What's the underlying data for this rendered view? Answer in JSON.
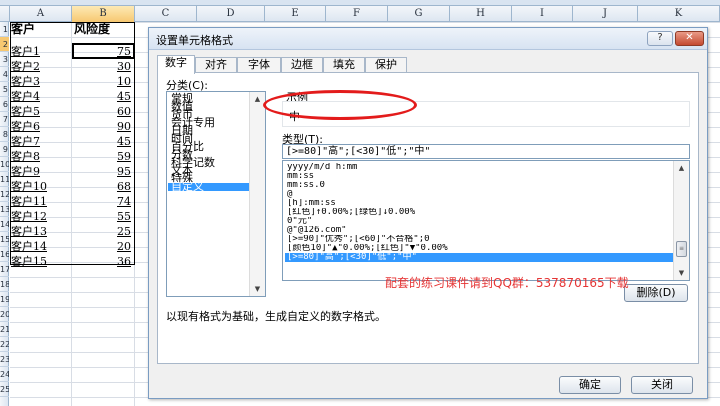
{
  "formula_bar": {
    "cell_ref": "B2",
    "fx_text": "75"
  },
  "columns": [
    "A",
    "B",
    "C",
    "D",
    "E",
    "F",
    "G",
    "H",
    "I",
    "J",
    "K"
  ],
  "rows": [
    "1",
    "2",
    "3",
    "4",
    "5",
    "6",
    "7",
    "8",
    "9",
    "10",
    "11",
    "12",
    "13",
    "14",
    "15",
    "16",
    "17",
    "18",
    "19",
    "20",
    "21",
    "22",
    "23",
    "24",
    "25"
  ],
  "sheet": {
    "header": {
      "a": "客户",
      "b": "风险度"
    },
    "data": [
      {
        "a": "客户1",
        "b": "75"
      },
      {
        "a": "客户2",
        "b": "30"
      },
      {
        "a": "客户3",
        "b": "10"
      },
      {
        "a": "客户4",
        "b": "45"
      },
      {
        "a": "客户5",
        "b": "60"
      },
      {
        "a": "客户6",
        "b": "90"
      },
      {
        "a": "客户7",
        "b": "45"
      },
      {
        "a": "客户8",
        "b": "59"
      },
      {
        "a": "客户9",
        "b": "95"
      },
      {
        "a": "客户10",
        "b": "68"
      },
      {
        "a": "客户11",
        "b": "74"
      },
      {
        "a": "客户12",
        "b": "55"
      },
      {
        "a": "客户13",
        "b": "25"
      },
      {
        "a": "客户14",
        "b": "20"
      },
      {
        "a": "客户15",
        "b": "36"
      }
    ]
  },
  "dialog": {
    "title": "设置单元格格式",
    "help_label": "?",
    "close_label": "✕",
    "tabs": [
      "数字",
      "对齐",
      "字体",
      "边框",
      "填充",
      "保护"
    ],
    "category_label": "分类(C):",
    "categories": [
      "常规",
      "数值",
      "货币",
      "会计专用",
      "日期",
      "时间",
      "百分比",
      "分数",
      "科学记数",
      "文本",
      "特殊",
      "自定义"
    ],
    "sample_label": "示例",
    "sample_value": "中",
    "type_label": "类型(T):",
    "type_value": "[>=80]\"高\";[<30]\"低\";\"中\"",
    "formats": [
      "yyyy/m/d h:mm",
      "mm:ss",
      "mm:ss.0",
      "@",
      "[h]:mm:ss",
      "[红色]↑0.00%;[绿色]↓0.00%",
      "0\"元\"",
      "@\"@126.com\"",
      "[>=90]\"优秀\";[<60]\"不合格\";0",
      "[颜色10]\"▲\"0.00%;[红色]\"▼\"0.00%",
      "[>=80]\"高\";[<30]\"低\";\"中\""
    ],
    "delete_label": "删除(D)",
    "description": "以现有格式为基础，生成自定义的数字格式。",
    "promo": "配套的练习课件请到QQ群：537870165下载",
    "ok_label": "确定",
    "cancel_label": "关闭"
  }
}
